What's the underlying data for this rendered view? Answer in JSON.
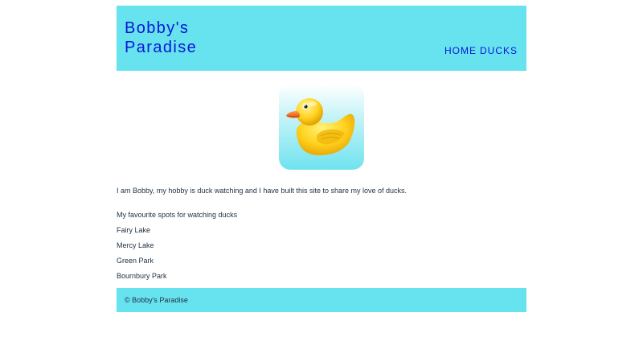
{
  "header": {
    "title_line1": "Bobby's",
    "title_line2": "Paradise",
    "nav": {
      "home": "HOME",
      "ducks": "DUCKS"
    }
  },
  "hero": {
    "icon": "rubber-duck-icon"
  },
  "content": {
    "intro": "I am Bobby, my hobby is duck watching and I have built this site to share my love of ducks.",
    "spots_heading": "My favourite spots for watching ducks",
    "spots": [
      "Fairy Lake",
      "Mercy Lake",
      "Green Park",
      "Bournbury Park"
    ]
  },
  "footer": {
    "text": "© Bobby's Paradise"
  },
  "colors": {
    "header_bg": "#66e3ef",
    "title_blue": "#0a16d6",
    "text": "#223344"
  }
}
